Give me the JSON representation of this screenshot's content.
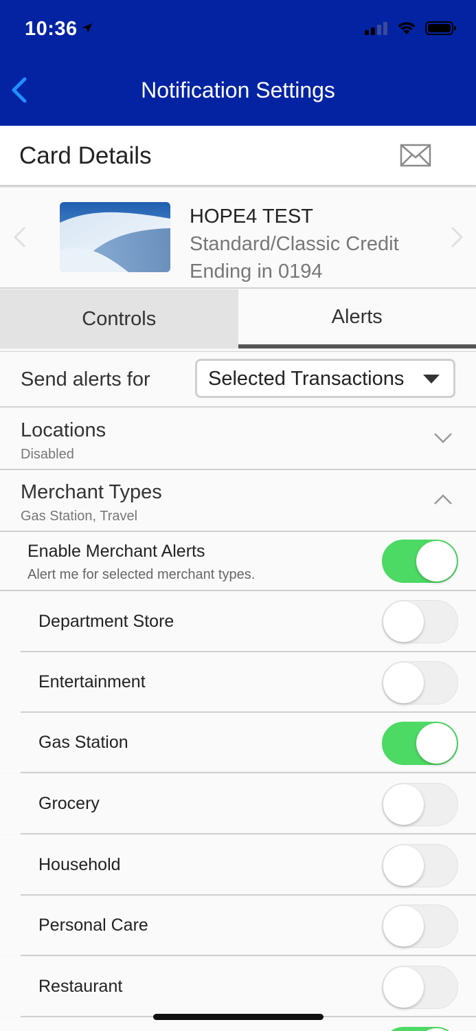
{
  "status_bar": {
    "time": "10:36"
  },
  "header": {
    "title": "Notification Settings"
  },
  "card_details": {
    "title": "Card Details"
  },
  "card": {
    "name": "HOPE4 TEST",
    "type": "Standard/Classic Credit",
    "ending": "Ending in 0194"
  },
  "tabs": [
    {
      "label": "Controls",
      "active": false
    },
    {
      "label": "Alerts",
      "active": true
    }
  ],
  "send_alerts": {
    "label": "Send alerts for",
    "selected": "Selected Transactions"
  },
  "locations": {
    "title": "Locations",
    "status": "Disabled",
    "expanded": false
  },
  "merchant_types": {
    "title": "Merchant Types",
    "summary": "Gas Station, Travel",
    "expanded": true
  },
  "enable_merchant": {
    "title": "Enable Merchant Alerts",
    "subtitle": "Alert me for selected merchant types.",
    "on": true
  },
  "merchants": [
    {
      "label": "Department Store",
      "on": false
    },
    {
      "label": "Entertainment",
      "on": false
    },
    {
      "label": "Gas Station",
      "on": true
    },
    {
      "label": "Grocery",
      "on": false
    },
    {
      "label": "Household",
      "on": false
    },
    {
      "label": "Personal Care",
      "on": false
    },
    {
      "label": "Restaurant",
      "on": false
    }
  ],
  "colors": {
    "header": "#0323a3",
    "toggle_on": "#4cd964",
    "back_accent": "#1e90ff"
  }
}
